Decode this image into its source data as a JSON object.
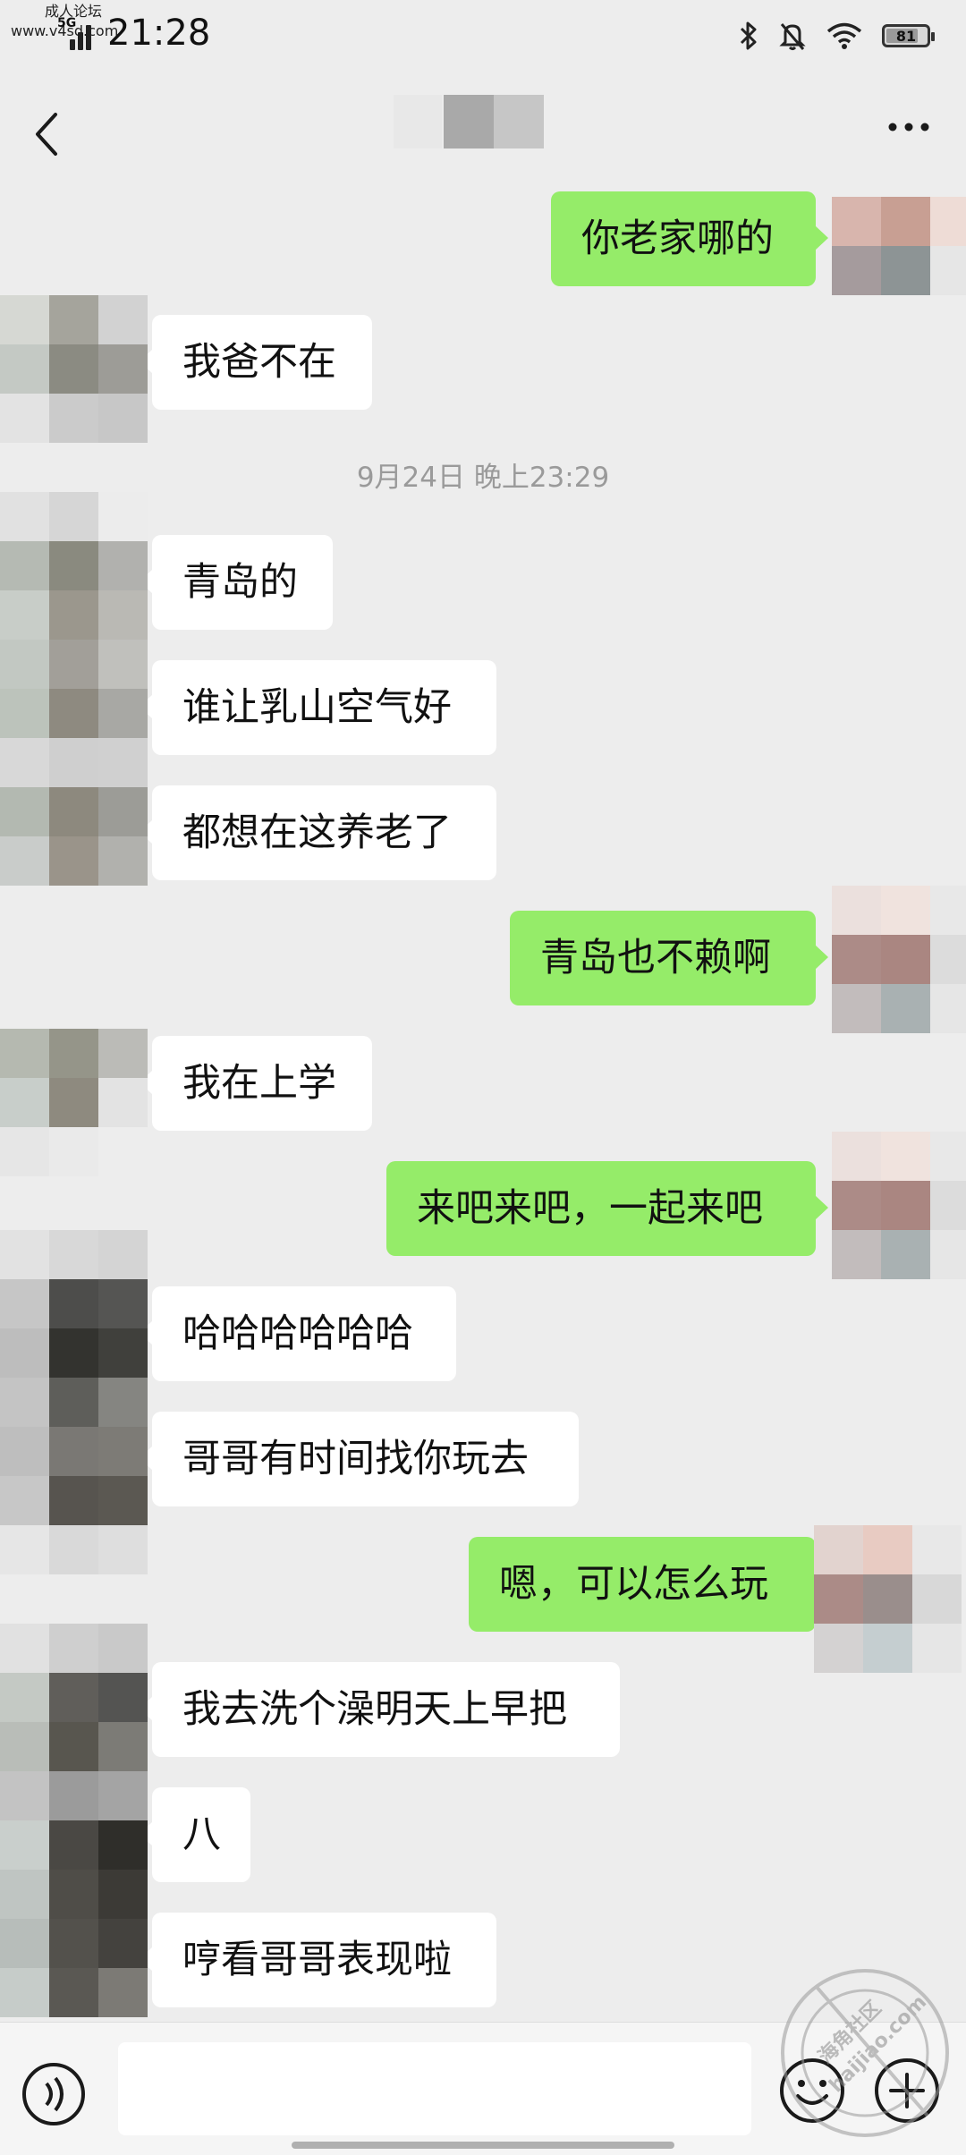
{
  "status_bar": {
    "watermark_line1": "成人论坛",
    "watermark_line2": "www.v4sd.com",
    "network": "5G",
    "time": "21:28",
    "battery_text": "81",
    "battery_level": 0.81
  },
  "nav": {
    "back_icon": "chevron-left-icon",
    "more_icon": "ellipsis-icon"
  },
  "timestamp": "9月24日 晚上23:29",
  "messages": [
    {
      "from": "me",
      "text": "你老家哪的"
    },
    {
      "from": "other",
      "text": "我爸不在"
    },
    {
      "from": "other",
      "text": "青岛的"
    },
    {
      "from": "other",
      "text": "谁让乳山空气好"
    },
    {
      "from": "other",
      "text": "都想在这养老了"
    },
    {
      "from": "me",
      "text": "青岛也不赖啊"
    },
    {
      "from": "other",
      "text": "我在上学"
    },
    {
      "from": "me",
      "text": "来吧来吧，一起来吧"
    },
    {
      "from": "other",
      "text": "哈哈哈哈哈哈"
    },
    {
      "from": "other",
      "text": "哥哥有时间找你玩去"
    },
    {
      "from": "me",
      "text": "嗯，可以怎么玩"
    },
    {
      "from": "other",
      "text": "我去洗个澡明天上早把"
    },
    {
      "from": "other",
      "text": "八"
    },
    {
      "from": "other",
      "text": "哼看哥哥表现啦"
    }
  ],
  "input_bar": {
    "voice_icon": "voice-icon",
    "input_value": "",
    "emoji_icon": "emoji-icon",
    "plus_icon": "plus-icon"
  },
  "site_watermark": {
    "line1": "海角社区",
    "line2": "haijiao.com"
  },
  "colors": {
    "background": "#ededed",
    "outgoing_bubble": "#95ec69",
    "incoming_bubble": "#ffffff",
    "timestamp_text": "#9a9a9a"
  }
}
